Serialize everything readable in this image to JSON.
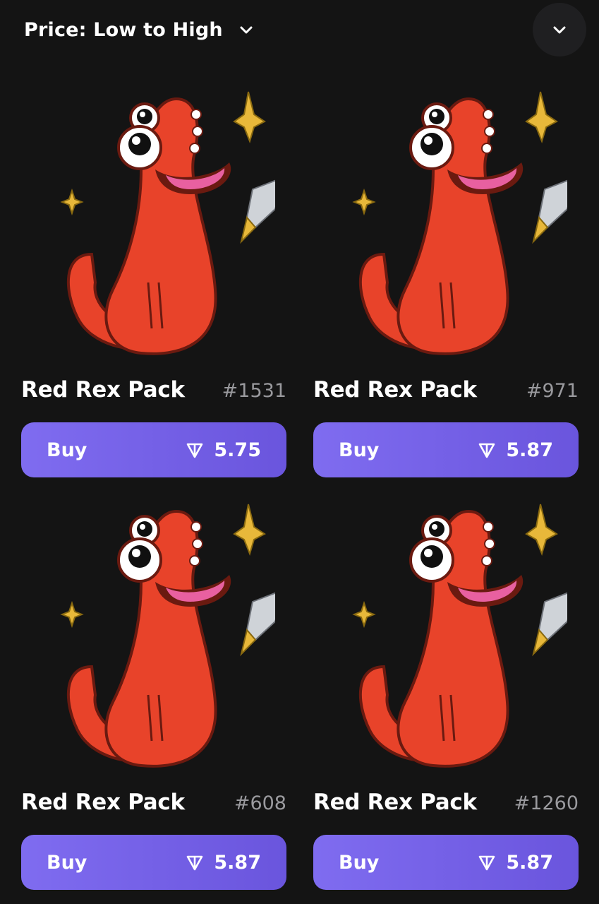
{
  "toolbar": {
    "sort_label": "Price: Low to High",
    "sort_icon": "chevron-down-icon",
    "expand_icon": "chevron-down-icon"
  },
  "currency_icon": "ton-diamond-icon",
  "colors": {
    "background": "#141414",
    "button_gradient_start": "#7f6cf0",
    "button_gradient_end": "#6a55dd",
    "number_text": "#9a9a9e",
    "sticker_body": "#e8432a"
  },
  "items": [
    {
      "name": "Red Rex Pack",
      "number": "#1531",
      "buy_label": "Buy",
      "price": "5.75"
    },
    {
      "name": "Red Rex Pack",
      "number": "#971",
      "buy_label": "Buy",
      "price": "5.87"
    },
    {
      "name": "Red Rex Pack",
      "number": "#608",
      "buy_label": "Buy",
      "price": "5.87"
    },
    {
      "name": "Red Rex Pack",
      "number": "#1260",
      "buy_label": "Buy",
      "price": "5.87"
    }
  ]
}
